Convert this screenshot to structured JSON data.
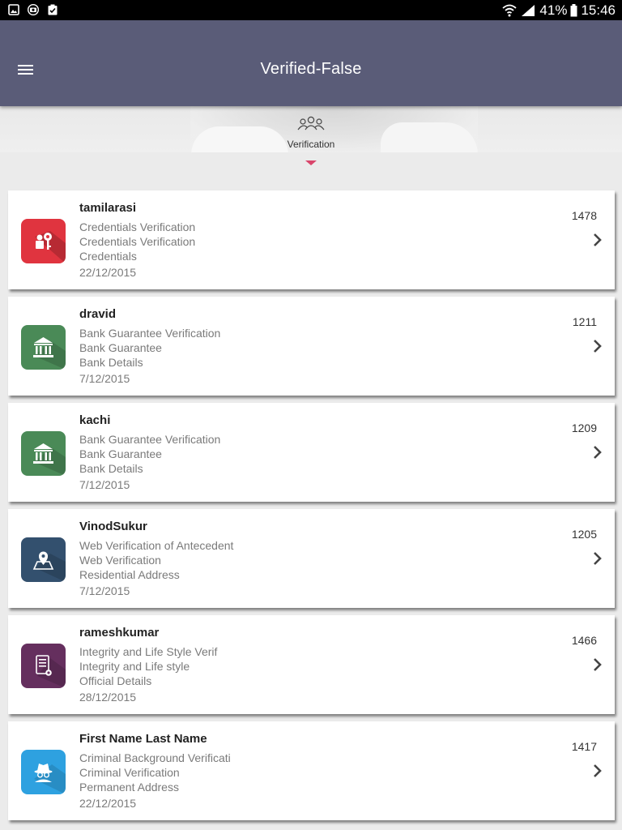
{
  "status_bar": {
    "icons": [
      "image-icon",
      "camera-icon",
      "clipboard-check-icon"
    ],
    "battery": "41%",
    "time": "15:46"
  },
  "app_bar": {
    "title": "Verified-False",
    "menu_icon": "hamburger-icon"
  },
  "tab": {
    "label": "Verification",
    "icon": "group-icon"
  },
  "accent_color": "#d9456b",
  "items": [
    {
      "name": "tamilarasi",
      "line1": "Credentials Verification",
      "line2": "Credentials Verification",
      "line3": "Credentials",
      "date": "22/12/2015",
      "id": "1478",
      "icon": "key-icon",
      "color": "#e0343f"
    },
    {
      "name": "dravid",
      "line1": "Bank Guarantee Verification",
      "line2": "Bank Guarantee",
      "line3": "Bank Details",
      "date": "7/12/2015",
      "id": "1211",
      "icon": "bank-icon",
      "color": "#4a8a57"
    },
    {
      "name": "kachi",
      "line1": "Bank Guarantee Verification",
      "line2": "Bank Guarantee",
      "line3": "Bank Details",
      "date": "7/12/2015",
      "id": "1209",
      "icon": "bank-icon",
      "color": "#4a8a57"
    },
    {
      "name": "VinodSukur",
      "line1": "Web Verification of Antecedent",
      "line2": "Web Verification",
      "line3": "Residential Address",
      "date": "7/12/2015",
      "id": "1205",
      "icon": "map-pin-icon",
      "color": "#33506e"
    },
    {
      "name": "rameshkumar",
      "line1": "Integrity and Life Style Verif",
      "line2": "Integrity and Life style",
      "line3": "Official Details",
      "date": "28/12/2015",
      "id": "1466",
      "icon": "certificate-icon",
      "color": "#652f5e"
    },
    {
      "name": "First Name Last Name",
      "line1": "Criminal Background Verificati",
      "line2": "Criminal Verification",
      "line3": "Permanent Address",
      "date": "22/12/2015",
      "id": "1417",
      "icon": "spy-icon",
      "color": "#2ea1e0"
    }
  ]
}
